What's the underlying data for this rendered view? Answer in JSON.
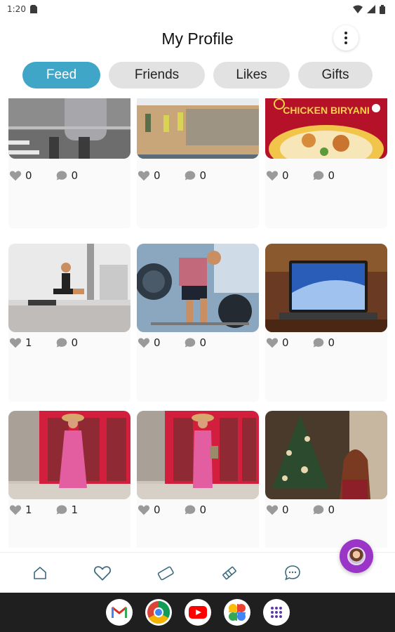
{
  "status_bar": {
    "time": "1:20"
  },
  "header": {
    "title": "My Profile"
  },
  "tabs": [
    {
      "label": "Feed",
      "active": true
    },
    {
      "label": "Friends",
      "active": false
    },
    {
      "label": "Likes",
      "active": false
    },
    {
      "label": "Gifts",
      "active": false
    }
  ],
  "posts": [
    {
      "image": "woman-walking-street-photo",
      "likes": "0",
      "comments": "0"
    },
    {
      "image": "construction-workers-site-photo",
      "likes": "0",
      "comments": "0"
    },
    {
      "image": "chicken-biryani-ad",
      "image_text": "CHICKEN BIRYANI",
      "likes": "0",
      "comments": "0"
    },
    {
      "image": "woman-lunge-gym-photo",
      "likes": "1",
      "comments": "0"
    },
    {
      "image": "woman-deadlift-barbell-photo",
      "likes": "0",
      "comments": "0"
    },
    {
      "image": "laptop-on-desk-photo",
      "likes": "0",
      "comments": "0"
    },
    {
      "image": "woman-pink-dress-red-door-photo",
      "likes": "1",
      "comments": "1"
    },
    {
      "image": "woman-pink-dress-red-door-photo",
      "likes": "0",
      "comments": "0"
    },
    {
      "image": "woman-christmas-tree-photo",
      "likes": "0",
      "comments": "0"
    }
  ],
  "bottom_nav": [
    {
      "icon": "home-icon"
    },
    {
      "icon": "heart-icon"
    },
    {
      "icon": "ticket-icon"
    },
    {
      "icon": "gift-pencil-icon"
    },
    {
      "icon": "chat-icon"
    }
  ],
  "dock_apps": [
    "gmail-icon",
    "chrome-icon",
    "youtube-icon",
    "photos-icon",
    "app-drawer-icon"
  ],
  "colors": {
    "accent": "#3fa6c8",
    "fab": "#9a35c8",
    "tab_inactive": "#e2e2e2",
    "nav_icon": "#3b6b80"
  }
}
